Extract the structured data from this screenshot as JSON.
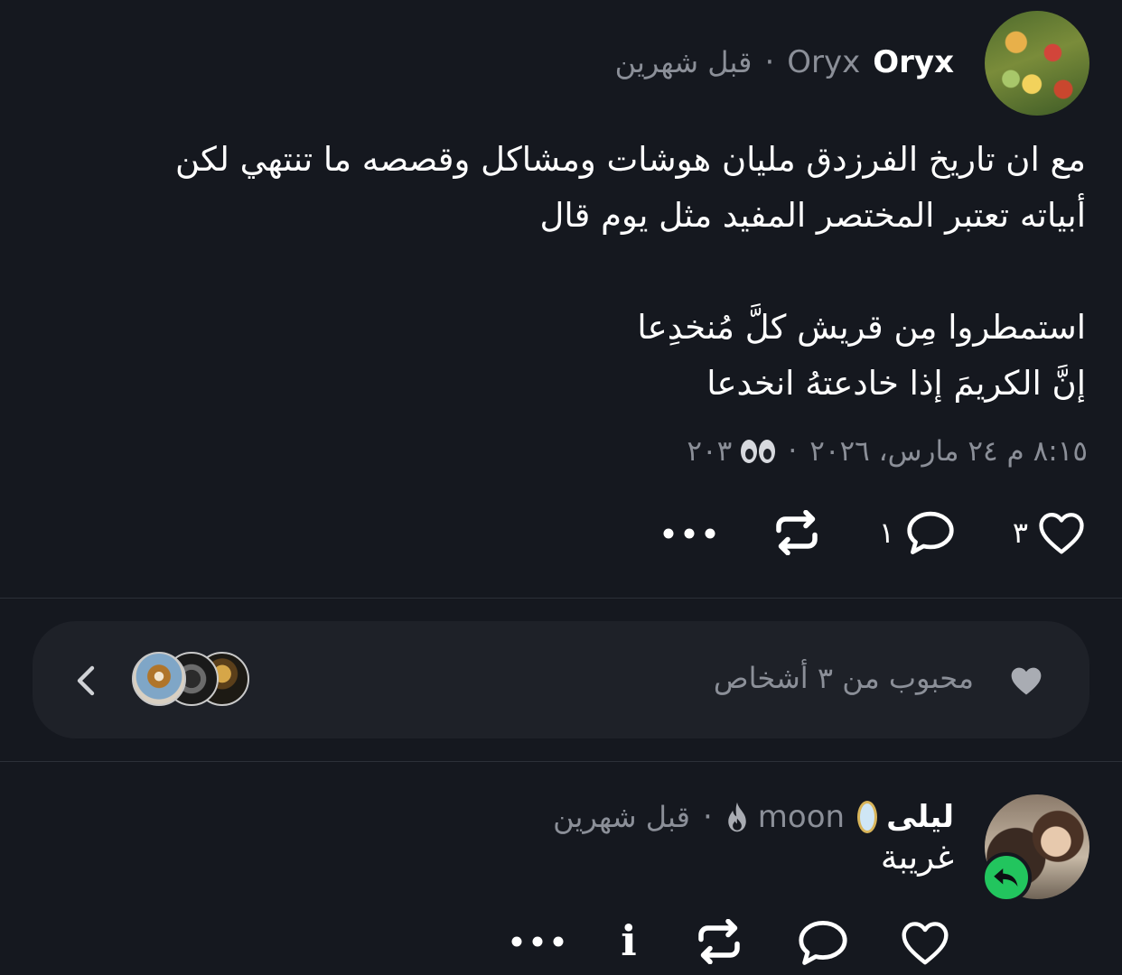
{
  "post": {
    "author_name": "Oryx",
    "author_handle": "Oryx",
    "separator": "·",
    "time_ago": "قبل شهرين",
    "body_lines": [
      "مع ان تاريخ الفرزدق مليان هوشات ومشاكل وقصصه ما تنتهي لكن",
      "أبياته تعتبر المختصر المفيد مثل يوم قال",
      "",
      "استمطروا مِن قريش كلَّ مُنخدِعا",
      "إنَّ الكريمَ إذا خادعتهُ انخدعا"
    ],
    "timestamp": "٨:١٥ م ٢٤ مارس، ٢٠٢٦",
    "stamp_separator": "·",
    "views": "٢٠٣",
    "views_icon": "eyes-icon",
    "likes_count": "٣",
    "replies_count": "١"
  },
  "likes_card": {
    "label": "محبوب من ٣ أشخاص",
    "icon": "heart-filled-icon",
    "chevron": "chevron-left-icon"
  },
  "reply": {
    "author_name": "ليلى",
    "author_emoji": "🪞",
    "author_handle": "moon",
    "handle_icon": "flame-icon",
    "separator": "·",
    "time_ago": "قبل شهرين",
    "text": "غريبة",
    "badge_icon": "reply-arrow-icon",
    "badge_color": "#22c55e",
    "info_label": "i"
  },
  "colors": {
    "background": "#15181f",
    "muted_text": "#8b8f98",
    "card": "#1e2128"
  }
}
